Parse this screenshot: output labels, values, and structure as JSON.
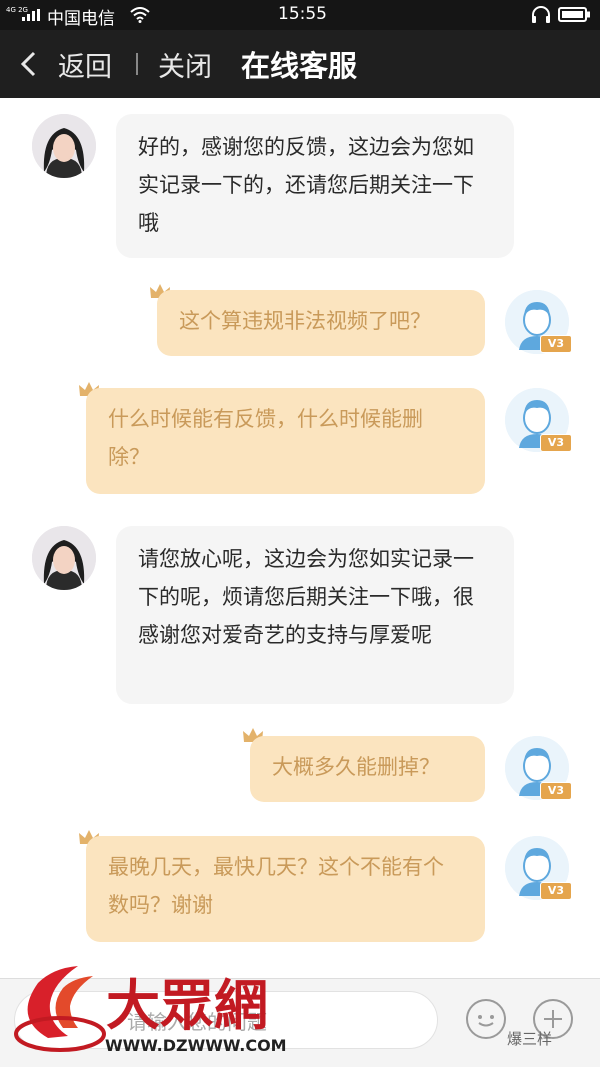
{
  "status_bar": {
    "network": "4G 2G",
    "carrier": "中国电信",
    "time": "15:55",
    "icons": [
      "signal-icon",
      "wifi-icon",
      "headset-icon",
      "battery-icon"
    ]
  },
  "nav": {
    "back_label": "返回",
    "close_label": "关闭",
    "title": "在线客服"
  },
  "messages": [
    {
      "from": "agent",
      "text": "好的，感谢您的反馈，这边会为您如实记录一下的，还请您后期关注一下哦"
    },
    {
      "from": "user",
      "badge": "V3",
      "text": "这个算违规非法视频了吧？"
    },
    {
      "from": "user",
      "badge": "V3",
      "text": "什么时候能有反馈，什么时候能删除？"
    },
    {
      "from": "agent",
      "text": "请您放心呢，这边会为您如实记录一下的呢，烦请您后期关注一下哦，很感谢您对爱奇艺的支持与厚爱呢"
    },
    {
      "from": "user",
      "badge": "V3",
      "text": "大概多久能删掉？"
    },
    {
      "from": "user",
      "badge": "V3",
      "text": "最晚几天，最快几天？这个不能有个数吗？谢谢"
    }
  ],
  "input": {
    "placeholder": "请输入您的问题"
  },
  "watermark": {
    "logo_text": "大眾網",
    "url": "WWW.DZWWW.COM",
    "account": "爆三样"
  },
  "colors": {
    "nav_bg": "#1f1f1f",
    "agent_bubble": "#f5f5f5",
    "user_bubble": "#fbe4bf",
    "user_text": "#c99a5a",
    "badge": "#e5a54d"
  }
}
